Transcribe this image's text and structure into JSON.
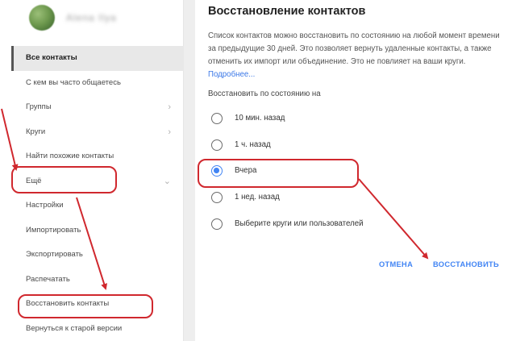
{
  "sidebar": {
    "account_name": "Alena Ilya",
    "items": [
      {
        "label": "Все контакты",
        "active": true,
        "chevron": ""
      },
      {
        "label": "С кем вы часто общаетесь",
        "active": false,
        "chevron": ""
      },
      {
        "label": "Группы",
        "active": false,
        "chevron": "›"
      },
      {
        "label": "Круги",
        "active": false,
        "chevron": "›"
      },
      {
        "label": "Найти похожие контакты",
        "active": false,
        "chevron": ""
      },
      {
        "label": "Ещё",
        "active": false,
        "chevron": "⌄"
      },
      {
        "label": "Настройки",
        "active": false,
        "chevron": ""
      },
      {
        "label": "Импортировать",
        "active": false,
        "chevron": ""
      },
      {
        "label": "Экспортировать",
        "active": false,
        "chevron": ""
      },
      {
        "label": "Распечатать",
        "active": false,
        "chevron": ""
      },
      {
        "label": "Восстановить контакты",
        "active": false,
        "chevron": ""
      },
      {
        "label": "Вернуться к старой версии",
        "active": false,
        "chevron": ""
      }
    ]
  },
  "dialog": {
    "title": "Восстановление контактов",
    "description": "Список контактов можно восстановить по состоянию на любой момент времени за предыдущие 30 дней. Это позволяет вернуть удаленные контакты, а также отменить их импорт или объединение. Это не повлияет на ваши круги.",
    "learn_more": "Подробнее...",
    "restore_as_of": "Восстановить по состоянию на",
    "options": [
      {
        "label": "10 мин. назад",
        "checked": false
      },
      {
        "label": "1 ч. назад",
        "checked": false
      },
      {
        "label": "Вчера",
        "checked": true
      },
      {
        "label": "1 нед. назад",
        "checked": false
      },
      {
        "label": "Выберите круги или пользователей",
        "checked": false
      }
    ],
    "cancel_label": "ОТМЕНА",
    "restore_label": "ВОССТАНОВИТЬ"
  },
  "colors": {
    "accent": "#4285f4",
    "annotation": "#d0282e",
    "active_bg": "#e8e8e8"
  }
}
